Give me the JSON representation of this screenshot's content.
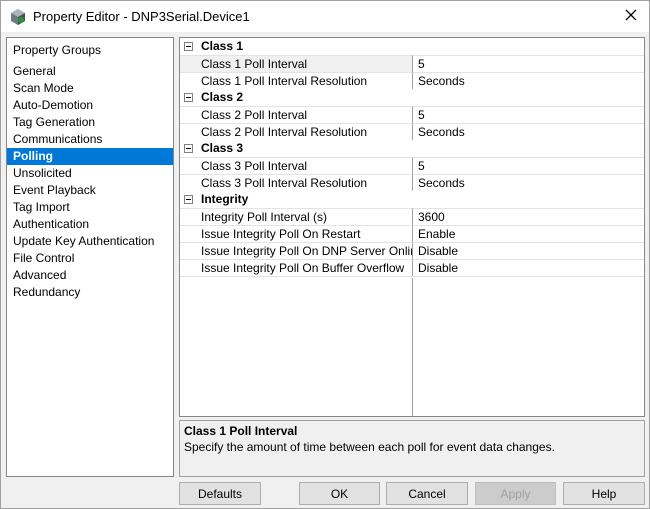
{
  "window": {
    "title": "Property Editor - DNP3Serial.Device1"
  },
  "groups": {
    "header": "Property Groups",
    "items": [
      {
        "label": "General"
      },
      {
        "label": "Scan Mode"
      },
      {
        "label": "Auto-Demotion"
      },
      {
        "label": "Tag Generation"
      },
      {
        "label": "Communications"
      },
      {
        "label": "Polling",
        "selected": true
      },
      {
        "label": "Unsolicited"
      },
      {
        "label": "Event Playback"
      },
      {
        "label": "Tag Import"
      },
      {
        "label": "Authentication"
      },
      {
        "label": "Update Key Authentication"
      },
      {
        "label": "File Control"
      },
      {
        "label": "Advanced"
      },
      {
        "label": "Redundancy"
      }
    ]
  },
  "grid": {
    "categories": [
      {
        "label": "Class 1",
        "props": [
          {
            "name": "Class 1 Poll Interval",
            "value": "5",
            "selected": true
          },
          {
            "name": "Class 1 Poll Interval Resolution",
            "value": "Seconds"
          }
        ]
      },
      {
        "label": "Class 2",
        "props": [
          {
            "name": "Class 2 Poll Interval",
            "value": "5"
          },
          {
            "name": "Class 2 Poll Interval Resolution",
            "value": "Seconds"
          }
        ]
      },
      {
        "label": "Class 3",
        "props": [
          {
            "name": "Class 3 Poll Interval",
            "value": "5"
          },
          {
            "name": "Class 3 Poll Interval Resolution",
            "value": "Seconds"
          }
        ]
      },
      {
        "label": "Integrity",
        "props": [
          {
            "name": "Integrity Poll Interval (s)",
            "value": "3600"
          },
          {
            "name": "Issue Integrity Poll On Restart",
            "value": "Enable"
          },
          {
            "name": "Issue Integrity Poll On DNP Server Online",
            "value": "Disable"
          },
          {
            "name": "Issue Integrity Poll On Buffer Overflow",
            "value": "Disable"
          }
        ]
      }
    ]
  },
  "description": {
    "title": "Class 1 Poll Interval",
    "text": "Specify the amount of time between each poll for event data changes."
  },
  "buttons": {
    "defaults": "Defaults",
    "ok": "OK",
    "cancel": "Cancel",
    "apply": "Apply",
    "help": "Help"
  },
  "icons": {
    "app": "property-editor-icon",
    "close": "close-icon",
    "collapse": "collapse-icon"
  },
  "colors": {
    "selection": "#0078d7",
    "window_bg": "#f0f0f0"
  }
}
